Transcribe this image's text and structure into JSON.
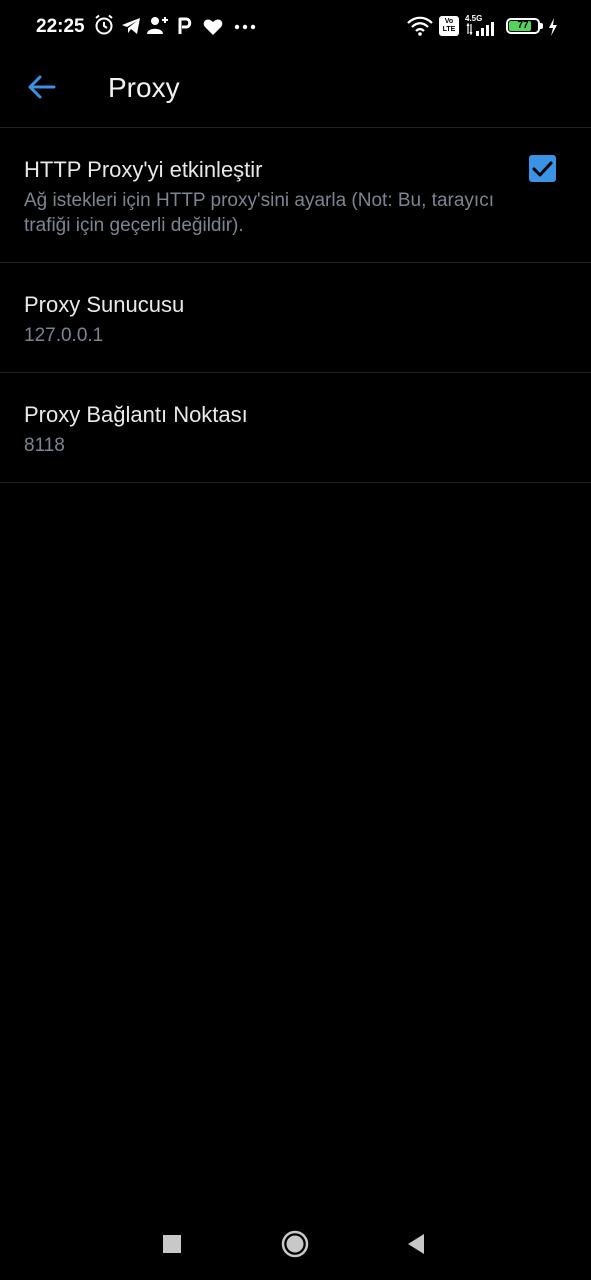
{
  "status_bar": {
    "time": "22:25",
    "icons": [
      "alarm-icon",
      "telegram-icon",
      "add-person-icon",
      "p-icon",
      "heart-icon",
      "more-dots-icon"
    ],
    "network_label": "4.5G",
    "volte_label": "Vo LTE",
    "battery_level": "77"
  },
  "app_bar": {
    "title": "Proxy"
  },
  "preferences": [
    {
      "title": "HTTP Proxy'yi etkinleştir",
      "summary": "Ağ istekleri için HTTP proxy'sini ayarla (Not: Bu, tarayıcı trafiği için geçerli değildir).",
      "checked": true
    },
    {
      "title": "Proxy Sunucusu",
      "summary": "127.0.0.1"
    },
    {
      "title": "Proxy Bağlantı Noktası",
      "summary": "8118"
    }
  ],
  "colors": {
    "accent": "#3a93e4",
    "background": "#000000",
    "summary_text": "#7d8590"
  }
}
